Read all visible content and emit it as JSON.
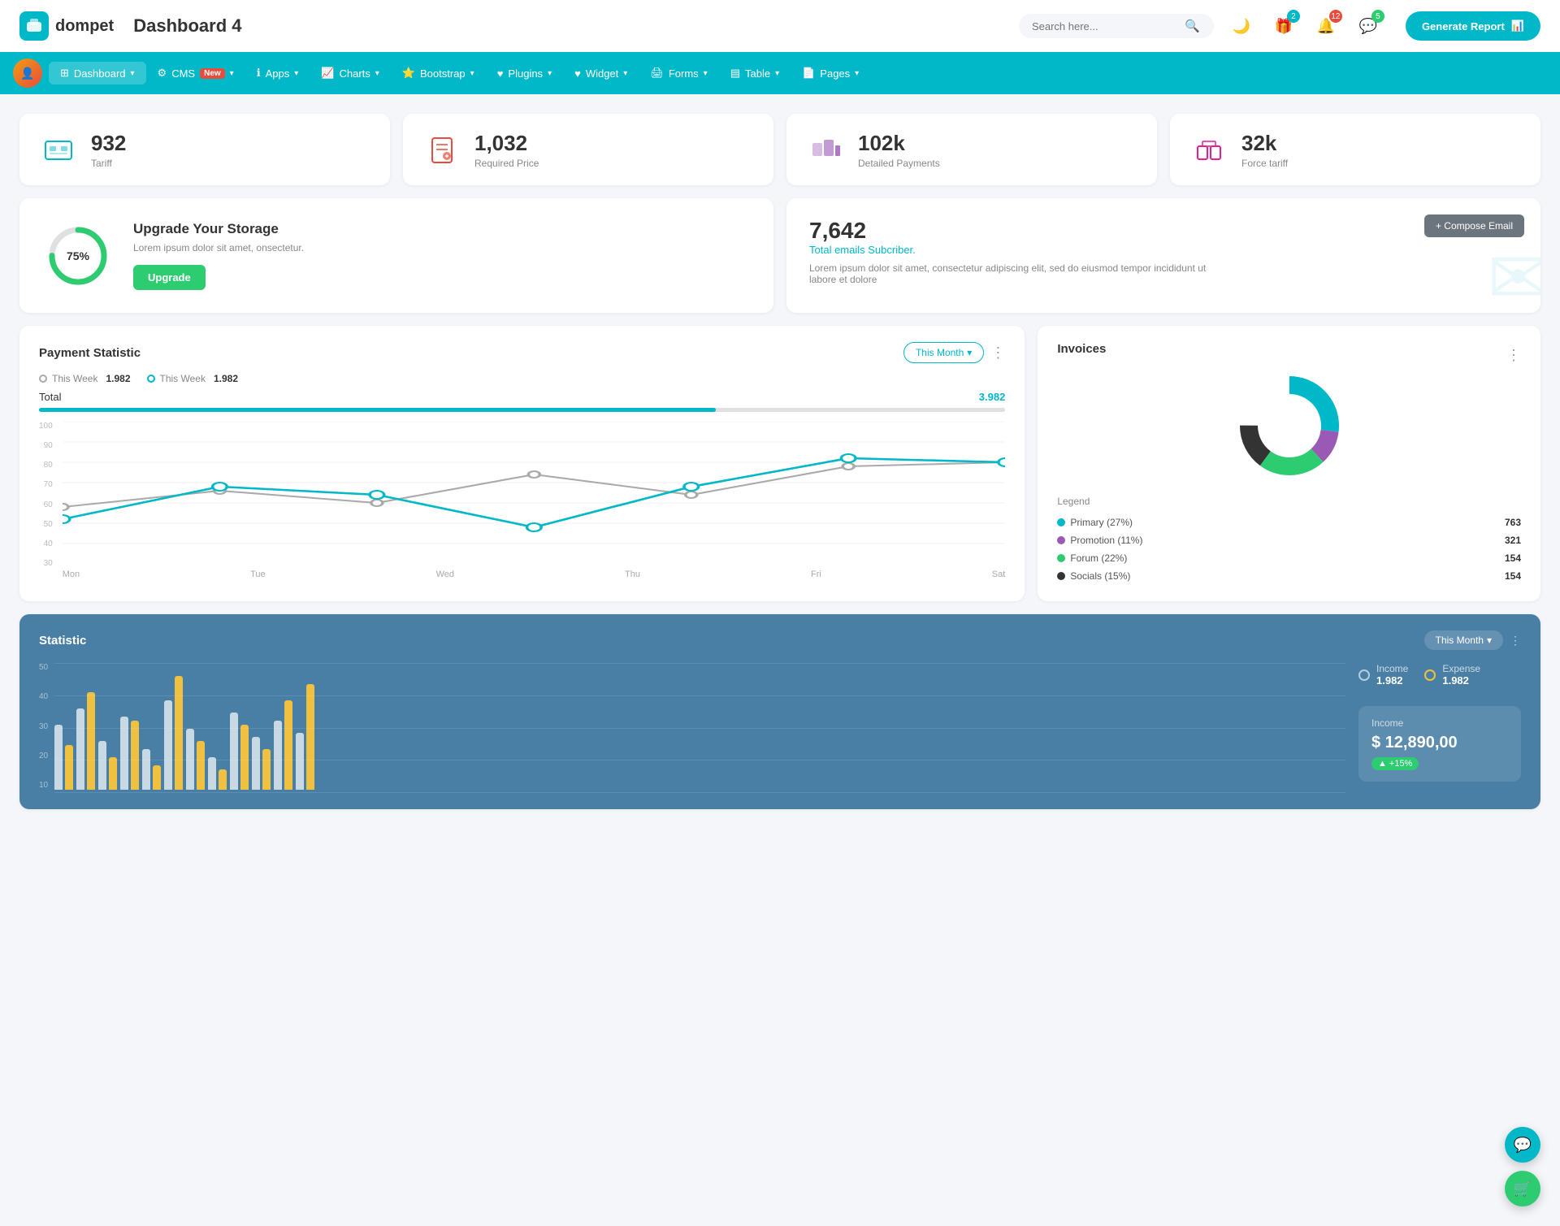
{
  "header": {
    "logo_text": "dompet",
    "page_title": "Dashboard 4",
    "search_placeholder": "Search here...",
    "generate_btn": "Generate Report",
    "badges": {
      "gift": "2",
      "bell": "12",
      "chat": "5"
    }
  },
  "nav": {
    "items": [
      {
        "label": "Dashboard",
        "active": true
      },
      {
        "label": "CMS",
        "badge": "New"
      },
      {
        "label": "Apps"
      },
      {
        "label": "Charts"
      },
      {
        "label": "Bootstrap"
      },
      {
        "label": "Plugins"
      },
      {
        "label": "Widget"
      },
      {
        "label": "Forms"
      },
      {
        "label": "Table"
      },
      {
        "label": "Pages"
      }
    ]
  },
  "stat_cards": [
    {
      "value": "932",
      "label": "Tariff",
      "color": "#00b8c8",
      "icon": "🏢"
    },
    {
      "value": "1,032",
      "label": "Required Price",
      "color": "#e74c3c",
      "icon": "📋"
    },
    {
      "value": "102k",
      "label": "Detailed Payments",
      "color": "#9b59b6",
      "icon": "🎯"
    },
    {
      "value": "32k",
      "label": "Force tariff",
      "color": "#e91e8c",
      "icon": "🏗"
    }
  ],
  "storage": {
    "percent": 75,
    "label": "75%",
    "title": "Upgrade Your Storage",
    "desc": "Lorem ipsum dolor sit amet, onsectetur.",
    "btn": "Upgrade"
  },
  "email": {
    "count": "7,642",
    "label": "Total emails Subcriber.",
    "desc": "Lorem ipsum dolor sit amet, consectetur adipiscing elit, sed do eiusmod tempor incididunt ut labore et dolore",
    "compose_btn": "+ Compose Email"
  },
  "payment": {
    "title": "Payment Statistic",
    "filter": "This Month",
    "legend1": "This Week",
    "legend2": "This Week",
    "val1": "1.982",
    "val2": "1.982",
    "total_label": "Total",
    "total_val": "3.982",
    "bar_pct": 70,
    "x_labels": [
      "Mon",
      "Tue",
      "Wed",
      "Thu",
      "Fri",
      "Sat"
    ],
    "y_labels": [
      "100",
      "90",
      "80",
      "70",
      "60",
      "50",
      "40",
      "30"
    ],
    "line1": "M 0,70 L 110,50 L 220,40 L 330,60 L 440,55 L 550,35 L 660,30",
    "line2": "M 0,90 L 110,70 L 220,60 L 330,50 L 440,65 L 550,60 L 660,25"
  },
  "invoices": {
    "title": "Invoices",
    "legend_title": "Legend",
    "items": [
      {
        "name": "Primary (27%)",
        "value": "763",
        "color": "#00b8c8"
      },
      {
        "name": "Promotion (11%)",
        "value": "321",
        "color": "#9b59b6"
      },
      {
        "name": "Forum (22%)",
        "value": "154",
        "color": "#2ecc71"
      },
      {
        "name": "Socials (15%)",
        "value": "154",
        "color": "#333"
      }
    ]
  },
  "statistic": {
    "title": "Statistic",
    "filter": "This Month",
    "income_label": "Income",
    "income_value": "1.982",
    "expense_label": "Expense",
    "expense_value": "1.982",
    "income_section": {
      "label": "Income",
      "value": "$ 12,890,00",
      "badge": "+15%"
    },
    "y_labels": [
      "50",
      "40",
      "30",
      "20",
      "10"
    ],
    "month_filter": "Month"
  }
}
